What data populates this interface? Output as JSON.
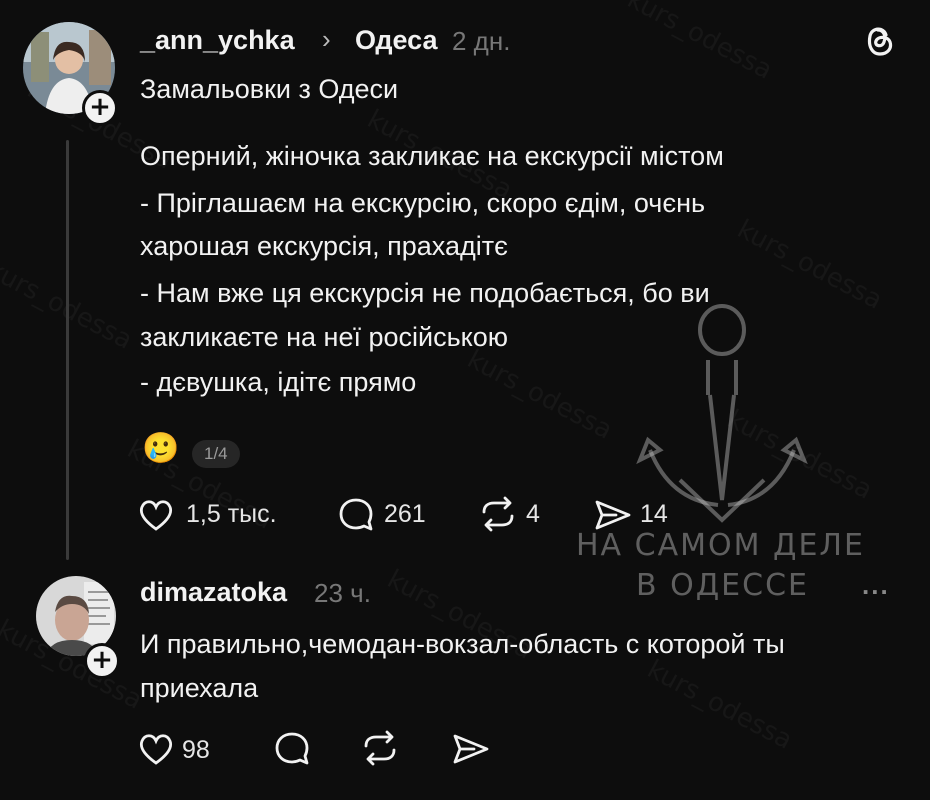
{
  "post": {
    "username": "_ann_ychka",
    "separator": "›",
    "topic": "Одеса",
    "time": "2 дн.",
    "title": "Замальовки з Одеси",
    "lines": [
      "Оперний, жіночка закликає на екскурсії містом",
      "- Пріглашаєм на екскурсію, скоро єдім, очєнь",
      "харошая екскурсія, прахадітє",
      "- Нам вже ця екскурсія не подобається, бо ви",
      "закликаєте на неї російською",
      "- дєвушка, ідітє прямо"
    ],
    "emoji": "🥲",
    "page_indicator": "1/4",
    "likes": "1,5 тыс.",
    "comments": "261",
    "reposts": "4",
    "shares": "14"
  },
  "reply": {
    "username": "dimazatoka",
    "time": "23 ч.",
    "lines": [
      "И правильно,чемодан-вокзал-область с которой ты",
      "приехала"
    ],
    "likes": "98",
    "more": "..."
  },
  "watermark": {
    "tag": "kurs_odessa",
    "logo_line1": "НА САМОМ ДЕЛЕ",
    "logo_line2": "В ОДЕССЕ"
  },
  "colors": {
    "background": "#0d0d0d",
    "text": "#f2f2f2",
    "muted": "#777777"
  },
  "icons": [
    "threads-logo-icon",
    "heart-icon",
    "comment-icon",
    "repost-icon",
    "share-icon",
    "plus-icon",
    "more-icon"
  ]
}
